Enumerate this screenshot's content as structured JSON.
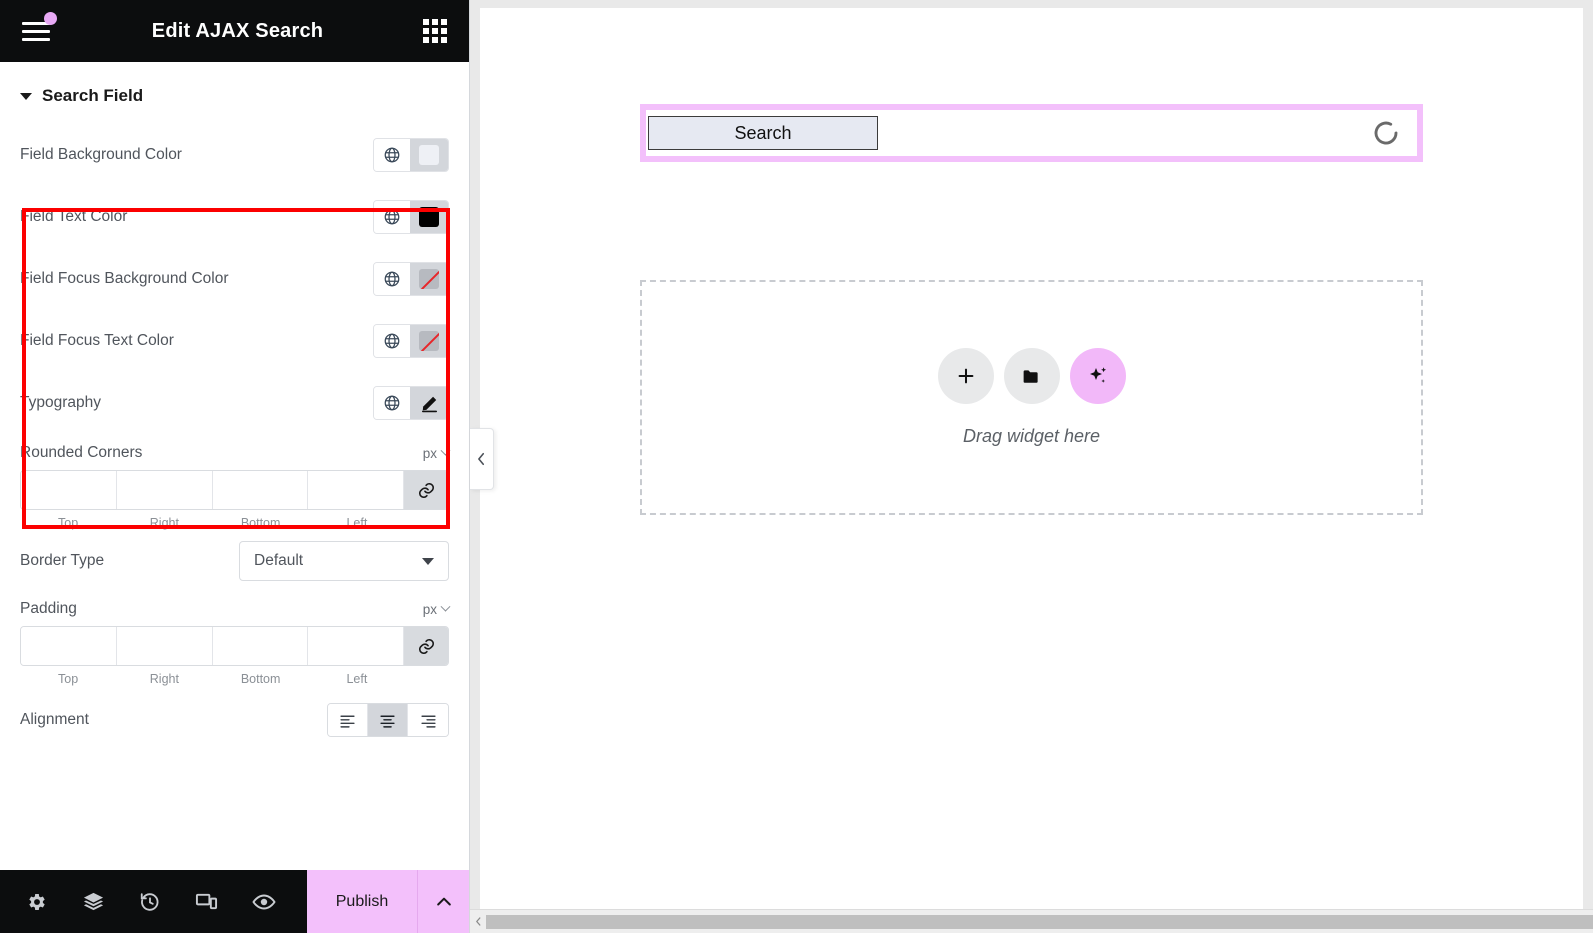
{
  "panel": {
    "header": {
      "title": "Edit AJAX Search",
      "menu_icon": "hamburger-menu-icon",
      "apps_icon": "apps-grid-icon",
      "notification_dot": true
    },
    "section": {
      "title": "Search Field",
      "expanded": true
    },
    "color_controls": [
      {
        "label": "Field Background Color",
        "swatch": "light",
        "swatch_color": "#EEF0F5",
        "global_icon": "globe-icon"
      },
      {
        "label": "Field Text Color",
        "swatch": "solid",
        "swatch_color": "#000000",
        "global_icon": "globe-icon"
      },
      {
        "label": "Field Focus Background Color",
        "swatch": "none",
        "swatch_color": "transparent",
        "global_icon": "globe-icon"
      },
      {
        "label": "Field Focus Text Color",
        "swatch": "none",
        "swatch_color": "transparent",
        "global_icon": "globe-icon"
      },
      {
        "label": "Typography",
        "swatch": "pencil",
        "swatch_color": "#000000",
        "global_icon": "globe-icon"
      }
    ],
    "rounded_corners": {
      "label": "Rounded Corners",
      "unit": "px",
      "values": {
        "top": "",
        "right": "",
        "bottom": "",
        "left": ""
      },
      "captions": {
        "top": "Top",
        "right": "Right",
        "bottom": "Bottom",
        "left": "Left"
      },
      "linked": true
    },
    "border_type": {
      "label": "Border Type",
      "value": "Default"
    },
    "padding": {
      "label": "Padding",
      "unit": "px",
      "values": {
        "top": "",
        "right": "",
        "bottom": "",
        "left": ""
      },
      "captions": {
        "top": "Top",
        "right": "Right",
        "bottom": "Bottom",
        "left": "Left"
      },
      "linked": true
    },
    "alignment": {
      "label": "Alignment",
      "options": [
        "left",
        "center",
        "right"
      ],
      "selected": "center"
    },
    "footer": {
      "icons": [
        "settings-gear-icon",
        "layers-navigator-icon",
        "history-icon",
        "responsive-mode-icon",
        "preview-eye-icon"
      ],
      "publish_label": "Publish",
      "publish_color": "#F3C0FB",
      "publish_arrow_icon": "chevron-up-icon"
    },
    "collapse_tab_icon": "chevron-left-icon"
  },
  "canvas": {
    "widget": {
      "selection_color": "#F3C0FB",
      "search_value": "Search",
      "search_bg": "#E6E9F2",
      "loading_icon": "spinner-icon"
    },
    "dropzone": {
      "text": "Drag widget here",
      "buttons": [
        {
          "icon": "plus-icon",
          "style": "default"
        },
        {
          "icon": "folder-icon",
          "style": "default"
        },
        {
          "icon": "ai-sparkle-icon",
          "style": "ai"
        }
      ]
    }
  },
  "annotation": {
    "highlight_color": "#FC0000"
  }
}
